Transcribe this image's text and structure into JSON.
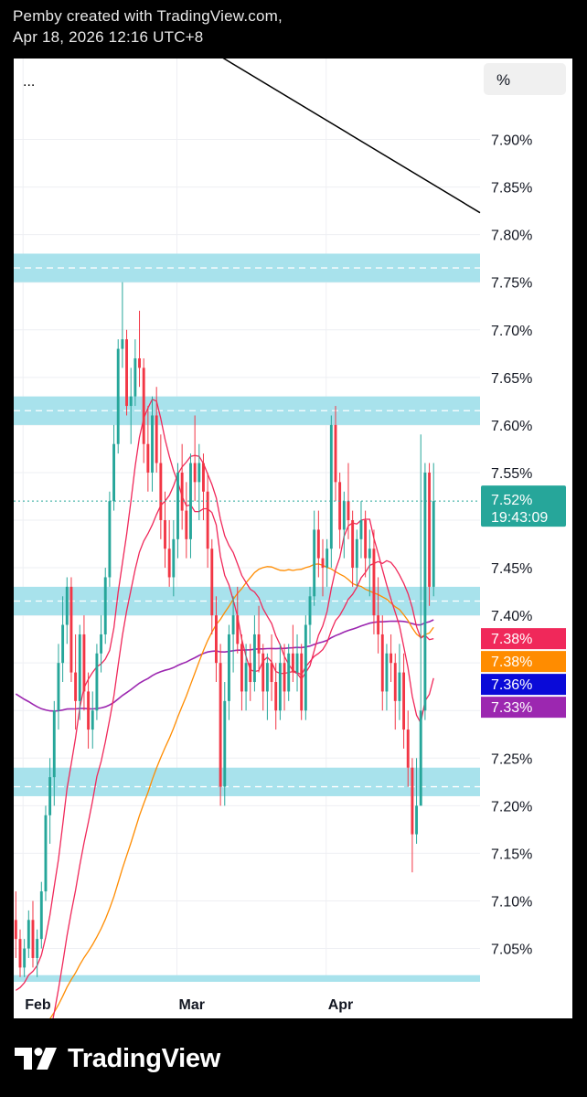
{
  "header": {
    "line1": "Pemby created with TradingView.com,",
    "line2": "Apr 18, 2026 12:16 UTC+8"
  },
  "toolbar": {
    "more_label": "...",
    "unit_label": "%"
  },
  "chart_data": {
    "type": "candlestick",
    "y_unit": "%",
    "ylim": [
      7.015,
      7.985
    ],
    "y_ticks": [
      "7.90%",
      "7.85%",
      "7.80%",
      "7.75%",
      "7.70%",
      "7.65%",
      "7.60%",
      "7.55%",
      "7.50%",
      "7.45%",
      "7.40%",
      "7.35%",
      "7.30%",
      "7.25%",
      "7.20%",
      "7.15%",
      "7.10%",
      "7.05%"
    ],
    "x_ticks": [
      "Feb",
      "Mar",
      "Apr"
    ],
    "grid": true,
    "last_price": {
      "value": 7.52,
      "label": "7.52%",
      "countdown": "19:43:09",
      "color": "#26a69a"
    },
    "zones": [
      {
        "from": 7.75,
        "to": 7.78,
        "mid": 7.765
      },
      {
        "from": 7.6,
        "to": 7.63,
        "mid": 7.615
      },
      {
        "from": 7.4,
        "to": 7.43,
        "mid": 7.415
      },
      {
        "from": 7.21,
        "to": 7.24,
        "mid": 7.22
      },
      {
        "from": 7.015,
        "to": 7.022,
        "mid": null
      }
    ],
    "trendline": {
      "from": [
        0.4,
        8.0
      ],
      "to": [
        1.0,
        7.823
      ]
    },
    "indicators": [
      {
        "label": "7.38%",
        "value": 7.38,
        "color": "#f0285a"
      },
      {
        "label": "7.38%",
        "value": 7.38,
        "color": "#ff8c00"
      },
      {
        "label": "7.36%",
        "value": 7.36,
        "color": "#0a0ad8"
      },
      {
        "label": "7.33%",
        "value": 7.33,
        "color": "#9c27b0"
      }
    ],
    "candles": [
      [
        7.08,
        7.11,
        7.04,
        7.06
      ],
      [
        7.06,
        7.07,
        7.02,
        7.03
      ],
      [
        7.03,
        7.06,
        7.02,
        7.05
      ],
      [
        7.05,
        7.09,
        7.04,
        7.08
      ],
      [
        7.08,
        7.1,
        7.03,
        7.04
      ],
      [
        7.04,
        7.07,
        7.02,
        7.06
      ],
      [
        7.06,
        7.12,
        7.05,
        7.11
      ],
      [
        7.11,
        7.2,
        7.1,
        7.19
      ],
      [
        7.19,
        7.25,
        7.16,
        7.23
      ],
      [
        7.23,
        7.31,
        7.2,
        7.3
      ],
      [
        7.3,
        7.37,
        7.28,
        7.35
      ],
      [
        7.35,
        7.42,
        7.33,
        7.39
      ],
      [
        7.39,
        7.44,
        7.37,
        7.43
      ],
      [
        7.43,
        7.44,
        7.33,
        7.34
      ],
      [
        7.34,
        7.38,
        7.28,
        7.31
      ],
      [
        7.31,
        7.39,
        7.29,
        7.38
      ],
      [
        7.38,
        7.4,
        7.3,
        7.32
      ],
      [
        7.32,
        7.34,
        7.26,
        7.28
      ],
      [
        7.28,
        7.32,
        7.26,
        7.3
      ],
      [
        7.3,
        7.37,
        7.29,
        7.36
      ],
      [
        7.36,
        7.4,
        7.34,
        7.38
      ],
      [
        7.38,
        7.45,
        7.37,
        7.44
      ],
      [
        7.44,
        7.53,
        7.43,
        7.52
      ],
      [
        7.52,
        7.6,
        7.51,
        7.58
      ],
      [
        7.58,
        7.69,
        7.57,
        7.68
      ],
      [
        7.68,
        7.75,
        7.66,
        7.69
      ],
      [
        7.69,
        7.7,
        7.61,
        7.62
      ],
      [
        7.62,
        7.66,
        7.58,
        7.63
      ],
      [
        7.63,
        7.69,
        7.62,
        7.67
      ],
      [
        7.67,
        7.72,
        7.64,
        7.66
      ],
      [
        7.66,
        7.67,
        7.56,
        7.58
      ],
      [
        7.58,
        7.62,
        7.53,
        7.55
      ],
      [
        7.55,
        7.63,
        7.53,
        7.61
      ],
      [
        7.61,
        7.64,
        7.55,
        7.56
      ],
      [
        7.56,
        7.59,
        7.48,
        7.5
      ],
      [
        7.5,
        7.53,
        7.45,
        7.47
      ],
      [
        7.47,
        7.5,
        7.43,
        7.44
      ],
      [
        7.44,
        7.5,
        7.42,
        7.48
      ],
      [
        7.48,
        7.56,
        7.46,
        7.55
      ],
      [
        7.55,
        7.58,
        7.49,
        7.51
      ],
      [
        7.51,
        7.54,
        7.46,
        7.48
      ],
      [
        7.48,
        7.57,
        7.46,
        7.56
      ],
      [
        7.56,
        7.61,
        7.52,
        7.54
      ],
      [
        7.54,
        7.58,
        7.5,
        7.56
      ],
      [
        7.56,
        7.57,
        7.5,
        7.53
      ],
      [
        7.53,
        7.55,
        7.45,
        7.47
      ],
      [
        7.47,
        7.48,
        7.38,
        7.4
      ],
      [
        7.4,
        7.42,
        7.33,
        7.35
      ],
      [
        7.35,
        7.37,
        7.2,
        7.22
      ],
      [
        7.22,
        7.33,
        7.2,
        7.31
      ],
      [
        7.31,
        7.39,
        7.29,
        7.38
      ],
      [
        7.38,
        7.42,
        7.34,
        7.4
      ],
      [
        7.4,
        7.43,
        7.36,
        7.37
      ],
      [
        7.37,
        7.38,
        7.3,
        7.32
      ],
      [
        7.32,
        7.37,
        7.3,
        7.35
      ],
      [
        7.35,
        7.37,
        7.31,
        7.33
      ],
      [
        7.33,
        7.4,
        7.32,
        7.38
      ],
      [
        7.38,
        7.41,
        7.34,
        7.36
      ],
      [
        7.36,
        7.37,
        7.3,
        7.32
      ],
      [
        7.32,
        7.36,
        7.29,
        7.35
      ],
      [
        7.35,
        7.38,
        7.31,
        7.33
      ],
      [
        7.33,
        7.35,
        7.28,
        7.3
      ],
      [
        7.3,
        7.37,
        7.29,
        7.35
      ],
      [
        7.35,
        7.37,
        7.3,
        7.32
      ],
      [
        7.32,
        7.37,
        7.31,
        7.36
      ],
      [
        7.36,
        7.39,
        7.33,
        7.34
      ],
      [
        7.34,
        7.38,
        7.32,
        7.36
      ],
      [
        7.36,
        7.37,
        7.29,
        7.3
      ],
      [
        7.3,
        7.4,
        7.29,
        7.39
      ],
      [
        7.39,
        7.43,
        7.37,
        7.42
      ],
      [
        7.42,
        7.51,
        7.41,
        7.49
      ],
      [
        7.49,
        7.51,
        7.44,
        7.46
      ],
      [
        7.46,
        7.48,
        7.42,
        7.45
      ],
      [
        7.45,
        7.48,
        7.43,
        7.47
      ],
      [
        7.47,
        7.61,
        7.45,
        7.6
      ],
      [
        7.6,
        7.62,
        7.52,
        7.54
      ],
      [
        7.54,
        7.55,
        7.47,
        7.49
      ],
      [
        7.49,
        7.53,
        7.46,
        7.52
      ],
      [
        7.52,
        7.56,
        7.48,
        7.5
      ],
      [
        7.5,
        7.51,
        7.43,
        7.45
      ],
      [
        7.45,
        7.49,
        7.43,
        7.48
      ],
      [
        7.48,
        7.52,
        7.46,
        7.5
      ],
      [
        7.5,
        7.51,
        7.44,
        7.46
      ],
      [
        7.46,
        7.49,
        7.42,
        7.47
      ],
      [
        7.47,
        7.49,
        7.38,
        7.4
      ],
      [
        7.4,
        7.44,
        7.36,
        7.38
      ],
      [
        7.38,
        7.4,
        7.3,
        7.32
      ],
      [
        7.32,
        7.37,
        7.3,
        7.36
      ],
      [
        7.36,
        7.38,
        7.33,
        7.35
      ],
      [
        7.35,
        7.36,
        7.28,
        7.31
      ],
      [
        7.31,
        7.37,
        7.29,
        7.34
      ],
      [
        7.34,
        7.36,
        7.26,
        7.28
      ],
      [
        7.28,
        7.3,
        7.22,
        7.24
      ],
      [
        7.24,
        7.25,
        7.13,
        7.17
      ],
      [
        7.17,
        7.25,
        7.16,
        7.2
      ],
      [
        7.2,
        7.59,
        7.3,
        7.3
      ],
      [
        7.3,
        7.56,
        7.29,
        7.55
      ],
      [
        7.55,
        7.56,
        7.41,
        7.43
      ],
      [
        7.43,
        7.56,
        7.42,
        7.52
      ]
    ]
  }
}
